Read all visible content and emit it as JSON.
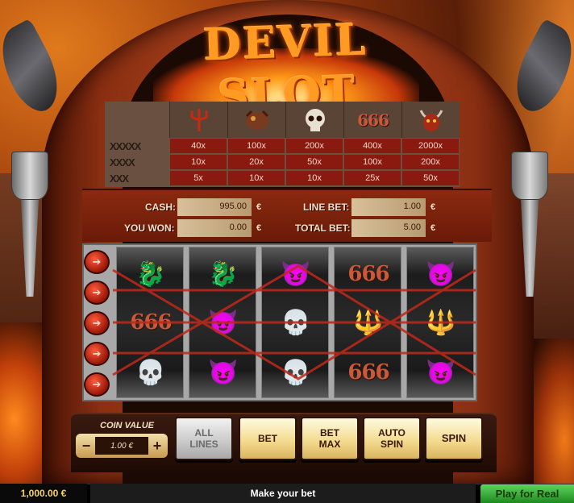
{
  "game": {
    "logo": "DEVIL SLOT"
  },
  "paytable": {
    "symbols": [
      "trident-icon",
      "dragon-icon",
      "skull-icon",
      "666-icon",
      "devil-icon"
    ],
    "six_label": "666",
    "combos": [
      "XXXXX",
      "XXXX",
      "XXX"
    ],
    "rows": [
      [
        "40x",
        "100x",
        "200x",
        "400x",
        "2000x"
      ],
      [
        "10x",
        "20x",
        "50x",
        "100x",
        "200x"
      ],
      [
        "5x",
        "10x",
        "10x",
        "25x",
        "50x"
      ]
    ]
  },
  "info": {
    "cash_label": "CASH:",
    "cash_value": "995.00",
    "cash_currency": "€",
    "won_label": "YOU WON:",
    "won_value": "0.00",
    "won_currency": "€",
    "line_bet_label": "LINE BET:",
    "line_bet_value": "1.00",
    "line_bet_currency": "€",
    "total_bet_label": "TOTAL BET:",
    "total_bet_value": "5.00",
    "total_bet_currency": "€"
  },
  "reels": {
    "six": "666",
    "columns": [
      [
        "dragon",
        "666",
        "skull"
      ],
      [
        "dragon",
        "devil",
        "devil"
      ],
      [
        "devil",
        "skull",
        "skull"
      ],
      [
        "666",
        "trident",
        "666"
      ],
      [
        "devil",
        "trident",
        "devil"
      ]
    ]
  },
  "controls": {
    "coin_value_label": "COIN VALUE",
    "coin_value": "1.00 €",
    "minus": "−",
    "plus": "+",
    "all_lines": "ALL\nLINES",
    "bet": "BET",
    "bet_max": "BET\nMAX",
    "auto_spin": "AUTO\nSPIN",
    "spin": "SPIN"
  },
  "statusbar": {
    "balance": "1,000.00 €",
    "message": "Make your bet",
    "play_real": "Play for Real"
  },
  "colors": {
    "accent": "#8a1a10",
    "spin_button": "#f2d88a",
    "play_real": "#2ea02e"
  }
}
